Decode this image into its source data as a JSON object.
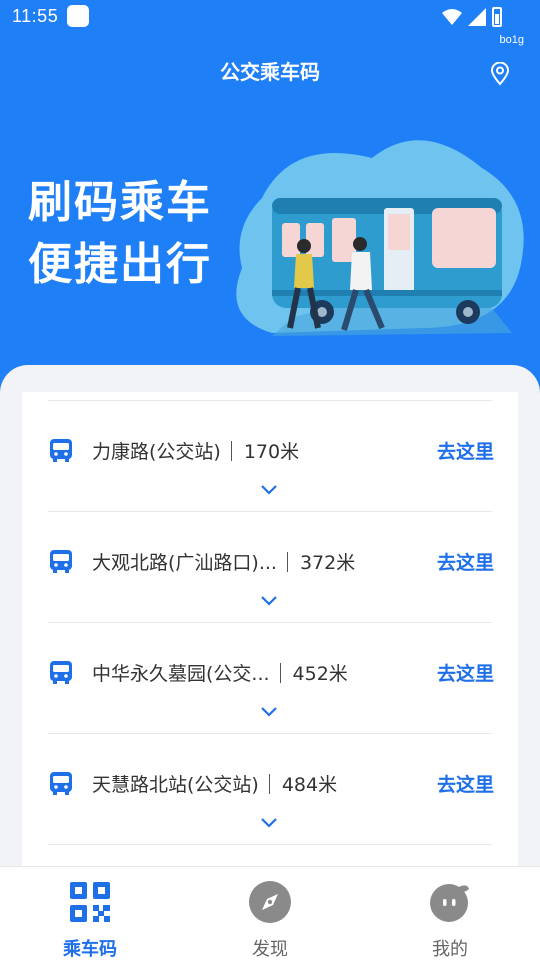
{
  "status_bar": {
    "time": "11:55",
    "extra_tag": "bo1g"
  },
  "header": {
    "title": "公交乘车码",
    "location_icon": "location-pin-icon"
  },
  "banner": {
    "slogan_line1": "刷码乘车",
    "slogan_line2": "便捷出行"
  },
  "stations": [
    {
      "name": "力康路(公交站)",
      "distance": "170米",
      "action": "去这里"
    },
    {
      "name": "大观北路(广汕路口)...",
      "distance": "372米",
      "action": "去这里"
    },
    {
      "name": "中华永久墓园(公交...",
      "distance": "452米",
      "action": "去这里"
    },
    {
      "name": "天慧路北站(公交站)",
      "distance": "484米",
      "action": "去这里"
    }
  ],
  "bottom_nav": [
    {
      "label": "乘车码",
      "icon": "qr-code-icon",
      "active": true
    },
    {
      "label": "发现",
      "icon": "compass-icon",
      "active": false
    },
    {
      "label": "我的",
      "icon": "profile-icon",
      "active": false
    }
  ],
  "colors": {
    "primary": "#1f7ff6",
    "action": "#1f6fe8",
    "inactive_icon": "#8a8a8a",
    "inactive_label": "#666666"
  }
}
